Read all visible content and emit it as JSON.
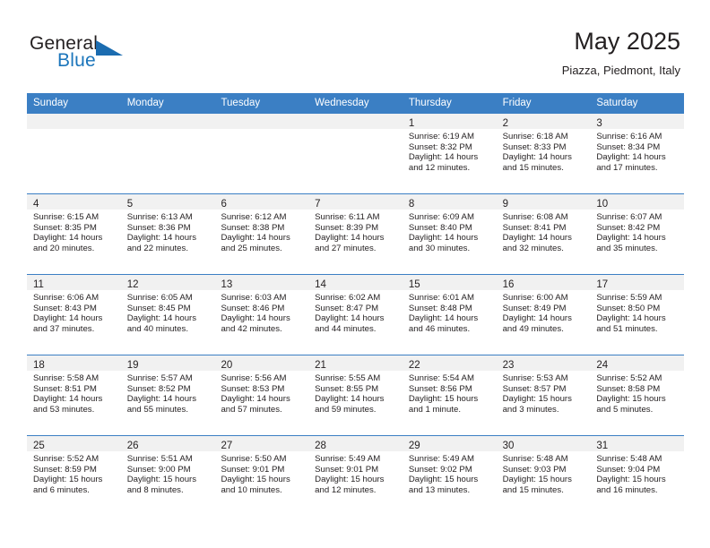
{
  "brand": {
    "general": "General",
    "blue": "Blue",
    "triangle_color": "#1b6cb0",
    "blue_color": "#1b75bb"
  },
  "header": {
    "title": "May 2025",
    "location": "Piazza, Piedmont, Italy"
  },
  "theme": {
    "header_row_bg": "#3b7fc4",
    "day_strip_bg": "#f1f1f1",
    "text_color": "#231f20"
  },
  "weekdays": [
    "Sunday",
    "Monday",
    "Tuesday",
    "Wednesday",
    "Thursday",
    "Friday",
    "Saturday"
  ],
  "weeks": [
    [
      {
        "day": "",
        "sunrise": "",
        "sunset": "",
        "daylight": ""
      },
      {
        "day": "",
        "sunrise": "",
        "sunset": "",
        "daylight": ""
      },
      {
        "day": "",
        "sunrise": "",
        "sunset": "",
        "daylight": ""
      },
      {
        "day": "",
        "sunrise": "",
        "sunset": "",
        "daylight": ""
      },
      {
        "day": "1",
        "sunrise": "Sunrise: 6:19 AM",
        "sunset": "Sunset: 8:32 PM",
        "daylight": "Daylight: 14 hours and 12 minutes."
      },
      {
        "day": "2",
        "sunrise": "Sunrise: 6:18 AM",
        "sunset": "Sunset: 8:33 PM",
        "daylight": "Daylight: 14 hours and 15 minutes."
      },
      {
        "day": "3",
        "sunrise": "Sunrise: 6:16 AM",
        "sunset": "Sunset: 8:34 PM",
        "daylight": "Daylight: 14 hours and 17 minutes."
      }
    ],
    [
      {
        "day": "4",
        "sunrise": "Sunrise: 6:15 AM",
        "sunset": "Sunset: 8:35 PM",
        "daylight": "Daylight: 14 hours and 20 minutes."
      },
      {
        "day": "5",
        "sunrise": "Sunrise: 6:13 AM",
        "sunset": "Sunset: 8:36 PM",
        "daylight": "Daylight: 14 hours and 22 minutes."
      },
      {
        "day": "6",
        "sunrise": "Sunrise: 6:12 AM",
        "sunset": "Sunset: 8:38 PM",
        "daylight": "Daylight: 14 hours and 25 minutes."
      },
      {
        "day": "7",
        "sunrise": "Sunrise: 6:11 AM",
        "sunset": "Sunset: 8:39 PM",
        "daylight": "Daylight: 14 hours and 27 minutes."
      },
      {
        "day": "8",
        "sunrise": "Sunrise: 6:09 AM",
        "sunset": "Sunset: 8:40 PM",
        "daylight": "Daylight: 14 hours and 30 minutes."
      },
      {
        "day": "9",
        "sunrise": "Sunrise: 6:08 AM",
        "sunset": "Sunset: 8:41 PM",
        "daylight": "Daylight: 14 hours and 32 minutes."
      },
      {
        "day": "10",
        "sunrise": "Sunrise: 6:07 AM",
        "sunset": "Sunset: 8:42 PM",
        "daylight": "Daylight: 14 hours and 35 minutes."
      }
    ],
    [
      {
        "day": "11",
        "sunrise": "Sunrise: 6:06 AM",
        "sunset": "Sunset: 8:43 PM",
        "daylight": "Daylight: 14 hours and 37 minutes."
      },
      {
        "day": "12",
        "sunrise": "Sunrise: 6:05 AM",
        "sunset": "Sunset: 8:45 PM",
        "daylight": "Daylight: 14 hours and 40 minutes."
      },
      {
        "day": "13",
        "sunrise": "Sunrise: 6:03 AM",
        "sunset": "Sunset: 8:46 PM",
        "daylight": "Daylight: 14 hours and 42 minutes."
      },
      {
        "day": "14",
        "sunrise": "Sunrise: 6:02 AM",
        "sunset": "Sunset: 8:47 PM",
        "daylight": "Daylight: 14 hours and 44 minutes."
      },
      {
        "day": "15",
        "sunrise": "Sunrise: 6:01 AM",
        "sunset": "Sunset: 8:48 PM",
        "daylight": "Daylight: 14 hours and 46 minutes."
      },
      {
        "day": "16",
        "sunrise": "Sunrise: 6:00 AM",
        "sunset": "Sunset: 8:49 PM",
        "daylight": "Daylight: 14 hours and 49 minutes."
      },
      {
        "day": "17",
        "sunrise": "Sunrise: 5:59 AM",
        "sunset": "Sunset: 8:50 PM",
        "daylight": "Daylight: 14 hours and 51 minutes."
      }
    ],
    [
      {
        "day": "18",
        "sunrise": "Sunrise: 5:58 AM",
        "sunset": "Sunset: 8:51 PM",
        "daylight": "Daylight: 14 hours and 53 minutes."
      },
      {
        "day": "19",
        "sunrise": "Sunrise: 5:57 AM",
        "sunset": "Sunset: 8:52 PM",
        "daylight": "Daylight: 14 hours and 55 minutes."
      },
      {
        "day": "20",
        "sunrise": "Sunrise: 5:56 AM",
        "sunset": "Sunset: 8:53 PM",
        "daylight": "Daylight: 14 hours and 57 minutes."
      },
      {
        "day": "21",
        "sunrise": "Sunrise: 5:55 AM",
        "sunset": "Sunset: 8:55 PM",
        "daylight": "Daylight: 14 hours and 59 minutes."
      },
      {
        "day": "22",
        "sunrise": "Sunrise: 5:54 AM",
        "sunset": "Sunset: 8:56 PM",
        "daylight": "Daylight: 15 hours and 1 minute."
      },
      {
        "day": "23",
        "sunrise": "Sunrise: 5:53 AM",
        "sunset": "Sunset: 8:57 PM",
        "daylight": "Daylight: 15 hours and 3 minutes."
      },
      {
        "day": "24",
        "sunrise": "Sunrise: 5:52 AM",
        "sunset": "Sunset: 8:58 PM",
        "daylight": "Daylight: 15 hours and 5 minutes."
      }
    ],
    [
      {
        "day": "25",
        "sunrise": "Sunrise: 5:52 AM",
        "sunset": "Sunset: 8:59 PM",
        "daylight": "Daylight: 15 hours and 6 minutes."
      },
      {
        "day": "26",
        "sunrise": "Sunrise: 5:51 AM",
        "sunset": "Sunset: 9:00 PM",
        "daylight": "Daylight: 15 hours and 8 minutes."
      },
      {
        "day": "27",
        "sunrise": "Sunrise: 5:50 AM",
        "sunset": "Sunset: 9:01 PM",
        "daylight": "Daylight: 15 hours and 10 minutes."
      },
      {
        "day": "28",
        "sunrise": "Sunrise: 5:49 AM",
        "sunset": "Sunset: 9:01 PM",
        "daylight": "Daylight: 15 hours and 12 minutes."
      },
      {
        "day": "29",
        "sunrise": "Sunrise: 5:49 AM",
        "sunset": "Sunset: 9:02 PM",
        "daylight": "Daylight: 15 hours and 13 minutes."
      },
      {
        "day": "30",
        "sunrise": "Sunrise: 5:48 AM",
        "sunset": "Sunset: 9:03 PM",
        "daylight": "Daylight: 15 hours and 15 minutes."
      },
      {
        "day": "31",
        "sunrise": "Sunrise: 5:48 AM",
        "sunset": "Sunset: 9:04 PM",
        "daylight": "Daylight: 15 hours and 16 minutes."
      }
    ]
  ]
}
